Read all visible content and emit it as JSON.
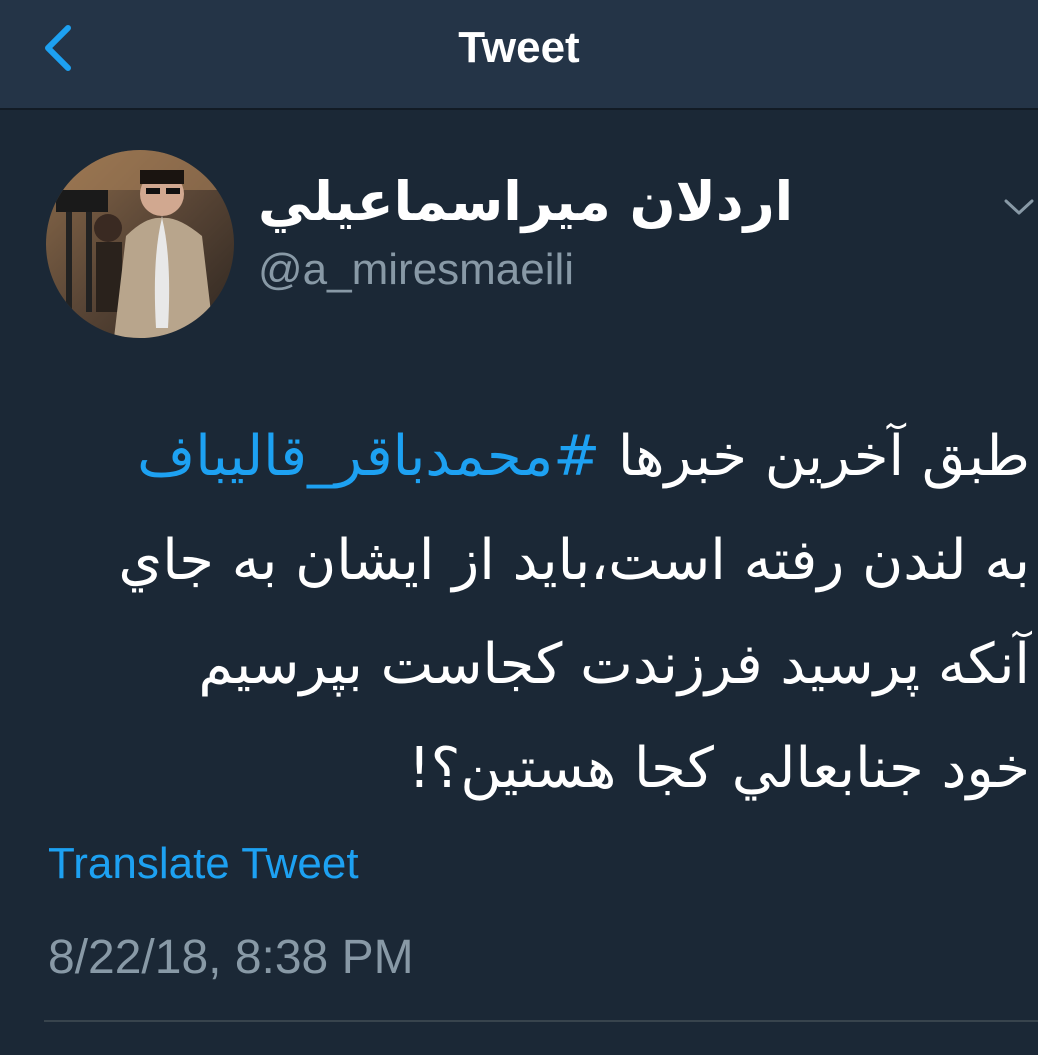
{
  "nav": {
    "title": "Tweet",
    "back_icon": "chevron-left-icon"
  },
  "colors": {
    "background": "#1b2836",
    "nav_background": "#243447",
    "accent": "#1da1f2",
    "secondary_text": "#8899a6"
  },
  "tweet": {
    "author": {
      "display_name": "اردلان ميراسماعيلي",
      "handle": "@a_miresmaeili",
      "avatar_icon": "avatar-photo"
    },
    "menu_icon": "chevron-down-icon",
    "text_lines": [
      {
        "before": "طبق آخرين خبرها ",
        "hashtag": "#محمدباقر_قاليباف",
        "after": ""
      },
      {
        "before": "به لندن رفته است،بايد از ايشان به جاي",
        "hashtag": "",
        "after": ""
      },
      {
        "before": "آنكه پرسيد فرزندت كجاست بپرسيم",
        "hashtag": "",
        "after": ""
      },
      {
        "before": "خود جنابعالي كجا هستين؟!",
        "hashtag": "",
        "after": ""
      }
    ],
    "translate_label": "Translate Tweet",
    "timestamp": "8/22/18, 8:38 PM"
  }
}
